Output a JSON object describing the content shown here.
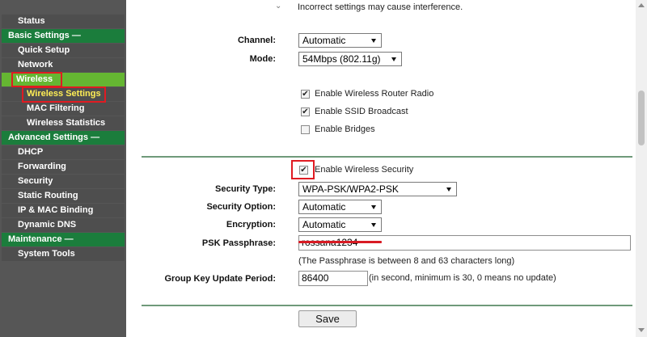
{
  "sidebar": {
    "items": [
      {
        "label": "Status"
      },
      {
        "label": "Basic Settings —"
      },
      {
        "label": "Quick Setup"
      },
      {
        "label": "Network"
      },
      {
        "label": "Wireless"
      },
      {
        "label": "Wireless Settings"
      },
      {
        "label": "MAC Filtering"
      },
      {
        "label": "Wireless Statistics"
      },
      {
        "label": "Advanced Settings —"
      },
      {
        "label": "DHCP"
      },
      {
        "label": "Forwarding"
      },
      {
        "label": "Security"
      },
      {
        "label": "Static Routing"
      },
      {
        "label": "IP & MAC Binding"
      },
      {
        "label": "Dynamic DNS"
      },
      {
        "label": "Maintenance —"
      },
      {
        "label": "System Tools"
      }
    ]
  },
  "warning_note": "Incorrect settings may cause interference.",
  "radio": {
    "channel_label": "Channel:",
    "channel_value": "Automatic",
    "mode_label": "Mode:",
    "mode_value": "54Mbps (802.11g)",
    "checkboxes": [
      {
        "label": "Enable Wireless Router Radio",
        "checked": true
      },
      {
        "label": "Enable SSID Broadcast",
        "checked": true
      },
      {
        "label": "Enable Bridges",
        "checked": false
      }
    ]
  },
  "security": {
    "enable_label": "Enable Wireless Security",
    "enable_checked": true,
    "type_label": "Security Type:",
    "type_value": "WPA-PSK/WPA2-PSK",
    "option_label": "Security Option:",
    "option_value": "Automatic",
    "encryption_label": "Encryption:",
    "encryption_value": "Automatic",
    "psk_label": "PSK Passphrase:",
    "psk_value": "rossana1234",
    "psk_hint": "(The Passphrase is between 8 and 63 characters long)",
    "group_key_label": "Group Key Update Period:",
    "group_key_value": "86400",
    "group_key_hint": "(in second, minimum is 30, 0 means no update)"
  },
  "save_label": "Save",
  "check_mark": "✔",
  "colors": {
    "sidebar_bg": "#565656",
    "section_green": "#1b7d3c",
    "active_green": "#65b632",
    "highlight_red": "#e01b22",
    "active_sub_text": "#ffee55",
    "divider": "#6f9a7a"
  }
}
